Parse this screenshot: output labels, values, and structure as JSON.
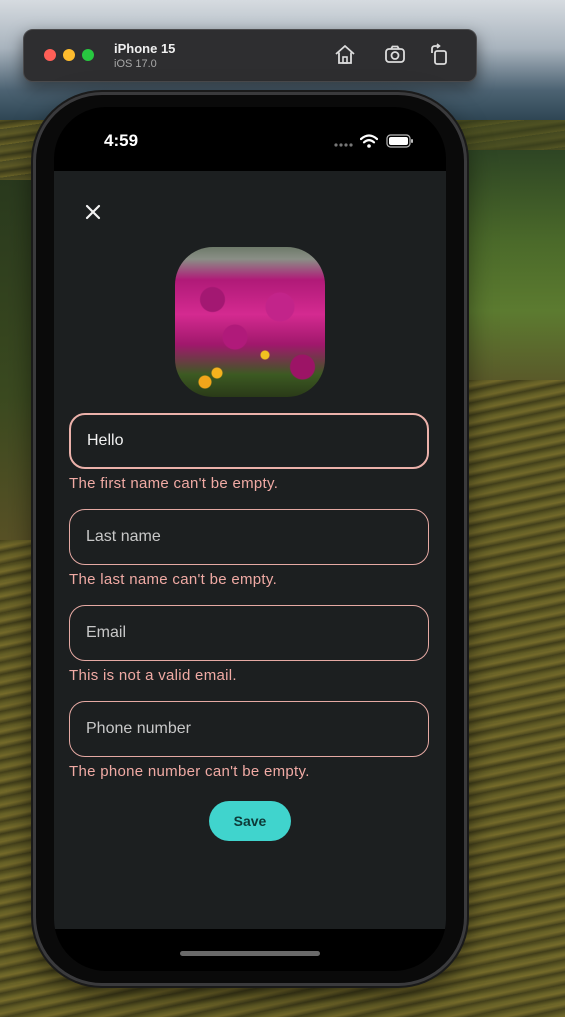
{
  "simulator": {
    "device_name": "iPhone 15",
    "os_version": "iOS 17.0",
    "icons": [
      "home-icon",
      "screenshot-icon",
      "rotate-icon"
    ]
  },
  "status_bar": {
    "time": "4:59"
  },
  "form": {
    "close_icon": "close-icon",
    "avatar_icon": "flower-photo",
    "fields": [
      {
        "name": "first-name",
        "value": "Hello",
        "placeholder": "",
        "error": "The first name can't be empty."
      },
      {
        "name": "last-name",
        "value": "",
        "placeholder": "Last name",
        "error": "The last name can't be empty."
      },
      {
        "name": "email",
        "value": "",
        "placeholder": "Email",
        "error": "This is not a valid email."
      },
      {
        "name": "phone-number",
        "value": "",
        "placeholder": "Phone number",
        "error": "The phone number can't be empty."
      }
    ],
    "save_label": "Save"
  },
  "colors": {
    "sheet_background": "#1c1f20",
    "field_border": "#e5a9a3",
    "error_text": "#f0aaa4",
    "save_button": "#40d4cd"
  }
}
